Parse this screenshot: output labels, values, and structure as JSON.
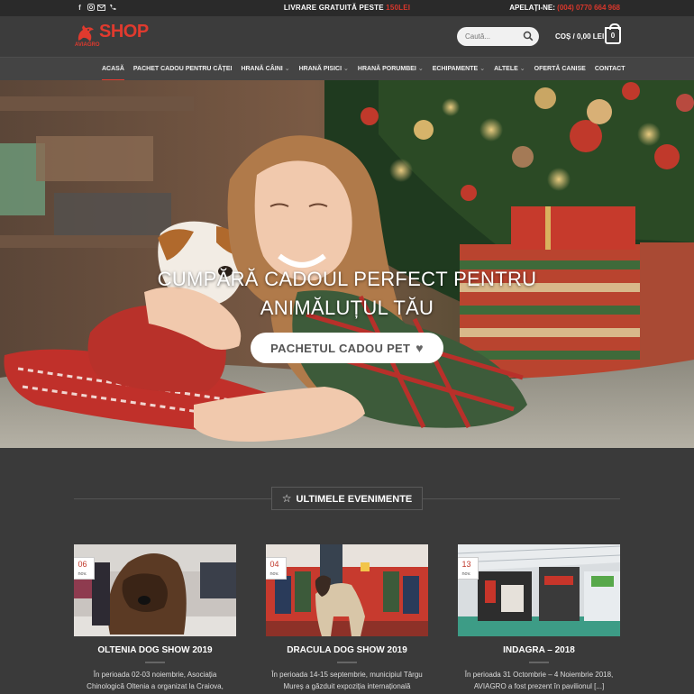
{
  "topbar": {
    "social_icons": [
      "facebook-icon",
      "instagram-icon",
      "email-icon",
      "phone-icon"
    ],
    "promo_text": "LIVRARE GRATUITĂ PESTE ",
    "promo_highlight": "150LEI",
    "phone_label": "APELAȚI-NE: ",
    "phone_number": "(004) 0770 664 968"
  },
  "header": {
    "logo_word": "SHOP",
    "logo_sub": "AVIAGRO",
    "search_placeholder": "Caută...",
    "cart_label": "COȘ / 0,00 LEI",
    "cart_count": "0"
  },
  "nav": {
    "items": [
      {
        "label": "ACASĂ",
        "dropdown": false
      },
      {
        "label": "PACHET CADOU PENTRU CĂȚEI",
        "dropdown": false
      },
      {
        "label": "HRANĂ CÂINI",
        "dropdown": true
      },
      {
        "label": "HRANĂ PISICI",
        "dropdown": true
      },
      {
        "label": "HRANĂ PORUMBEI",
        "dropdown": true
      },
      {
        "label": "ECHIPAMENTE",
        "dropdown": true
      },
      {
        "label": "ALTELE",
        "dropdown": true
      },
      {
        "label": "OFERTĂ CANISE",
        "dropdown": false
      },
      {
        "label": "CONTACT",
        "dropdown": false
      }
    ]
  },
  "hero": {
    "headline_line1": "CUMPĂRĂ CADOUL PERFECT PENTRU",
    "headline_line2": "ANIMĂLUȚUL TĂU",
    "cta_label": "PACHETUL CADOU PET"
  },
  "events": {
    "title": "ULTIMELE EVENIMENTE",
    "cards": [
      {
        "day": "06",
        "month": "nov.",
        "title": "OLTENIA DOG SHOW 2019",
        "excerpt": "În perioada 02-03 noiembrie, Asociația Chinologică Oltenia a organizat la Craiova, expoziția \"Oltenia Dog Show [...]"
      },
      {
        "day": "04",
        "month": "nov.",
        "title": "DRACULA DOG SHOW 2019",
        "excerpt": "În perioada 14-15 septembrie, municipiul Târgu Mureș a găzduit expoziția internațională \"Dracula Dog Show\" [...]"
      },
      {
        "day": "13",
        "month": "nov.",
        "title": "INDAGRA – 2018",
        "excerpt": "În perioada 31 Octombrie – 4 Noiembrie 2018, AVIAGRO a fost prezent în pavilionul [...]"
      }
    ]
  },
  "colors": {
    "accent": "#e03a2e",
    "topbar": "#2a2a2a",
    "header": "#3c3c3c",
    "body": "#3a3a3a"
  }
}
